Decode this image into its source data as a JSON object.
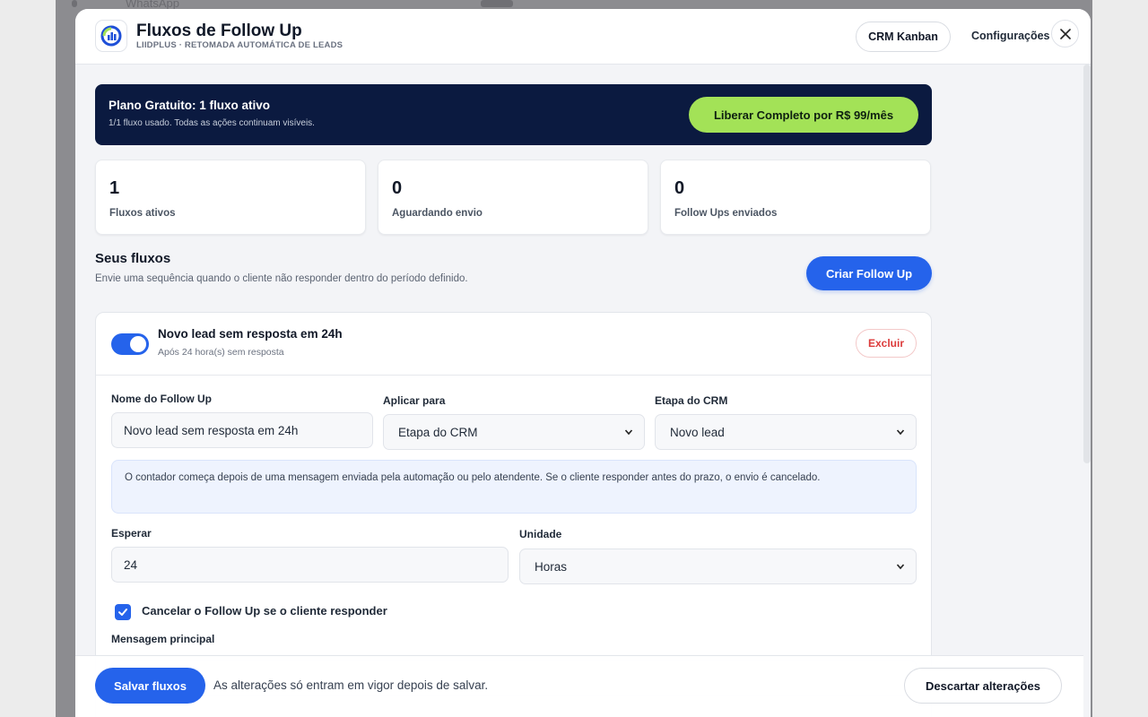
{
  "header": {
    "title": "Fluxos de Follow Up",
    "subtitle": "LIIDPLUS · RETOMADA AUTOMÁTICA DE LEADS",
    "crm_button": "CRM Kanban",
    "config_link": "Configurações",
    "close_icon": "close-icon"
  },
  "plan_banner": {
    "title": "Plano Gratuito: 1 fluxo ativo",
    "subtitle": "1/1 fluxo usado. Todas as ações continuam visíveis.",
    "upgrade_button": "Liberar Completo por R$ 99/mês"
  },
  "stats": [
    {
      "value": "1",
      "label": "Fluxos ativos"
    },
    {
      "value": "0",
      "label": "Aguardando envio"
    },
    {
      "value": "0",
      "label": "Follow Ups enviados"
    }
  ],
  "section": {
    "title": "Seus fluxos",
    "subtitle": "Envie uma sequência quando o cliente não responder dentro do período definido.",
    "create_button": "Criar Follow Up"
  },
  "flow": {
    "enabled": true,
    "name": "Novo lead sem resposta em 24h",
    "summary": "Após 24 hora(s) sem resposta",
    "delete_button": "Excluir",
    "fields": {
      "name_label": "Nome do Follow Up",
      "name_value": "Novo lead sem resposta em 24h",
      "apply_label": "Aplicar para",
      "apply_value": "Etapa do CRM",
      "stage_label": "Etapa do CRM",
      "stage_value": "Novo lead",
      "wait_label": "Esperar",
      "wait_value": "24",
      "unit_label": "Unidade",
      "unit_value": "Horas"
    },
    "notice": "O contador começa depois de uma mensagem enviada pela automação ou pelo atendente. Se o cliente responder antes do prazo, o envio é cancelado.",
    "cancel_checkbox_label": "Cancelar o Follow Up se o cliente responder",
    "cancel_checked": true,
    "message_label": "Mensagem principal"
  },
  "footer": {
    "save_button": "Salvar fluxos",
    "note": "As alterações só entram em vigor depois de salvar.",
    "discard_button": "Descartar alterações"
  },
  "background": {
    "ghost_text": "WhatsApp"
  },
  "colors": {
    "primary": "#2563eb",
    "banner_bg": "#0b1a40",
    "upgrade_green": "#a3e257",
    "danger": "#dc3b3b"
  }
}
